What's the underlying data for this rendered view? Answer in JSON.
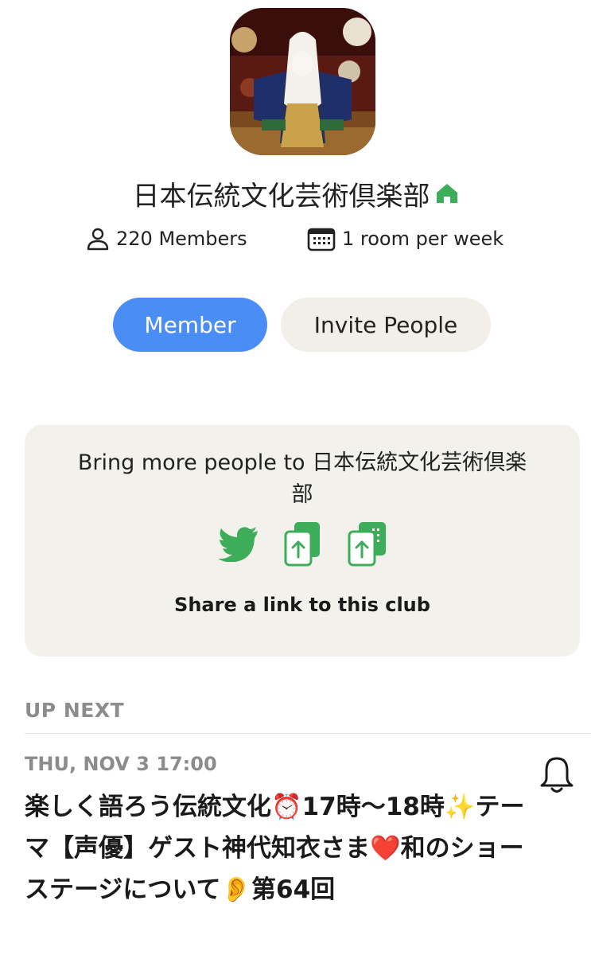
{
  "club": {
    "photo_icon": "kabuki-performer-photo",
    "name": "日本伝統文化芸術倶楽部",
    "home_icon": "green-house-icon",
    "members_label": "220 Members",
    "rooms_label": "1 room per week"
  },
  "actions": {
    "member_label": "Member",
    "invite_label": "Invite People"
  },
  "share": {
    "text": "Bring more people to 日本伝統文化芸術倶楽部",
    "caption": "Share a link to this club",
    "icons": [
      "twitter-icon",
      "copy-link-icon",
      "share-icon"
    ]
  },
  "up_next": {
    "heading": "UP NEXT",
    "event": {
      "time": "THU, NOV 3 17:00",
      "title": "楽しく語ろう伝統文化⏰17時〜18時✨テーマ【声優】ゲスト神代知衣さま❤️和のショーステージについて👂第64回"
    }
  },
  "colors": {
    "accent_blue": "#4a8ef5",
    "green": "#3ead5a",
    "card_bg": "#f2f1ec",
    "muted_text": "#8c8c8c"
  }
}
